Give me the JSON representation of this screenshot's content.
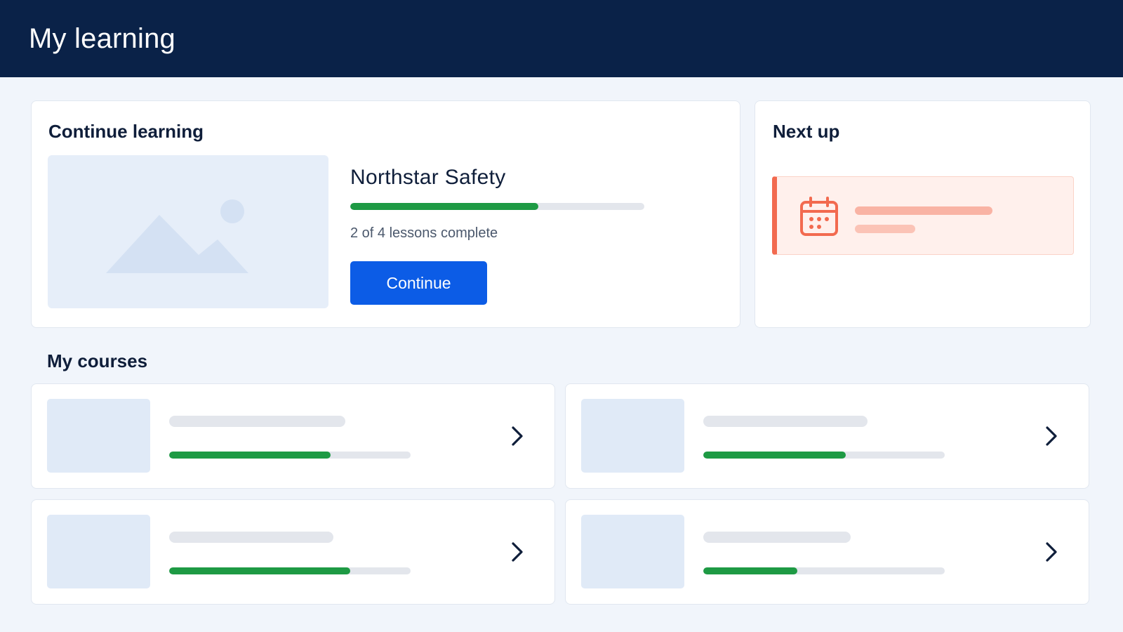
{
  "header": {
    "title": "My learning"
  },
  "continue_learning": {
    "title": "Continue learning",
    "course_name": "Northstar Safety",
    "progress": 0.64,
    "lessons_text": "2 of 4 lessons complete",
    "button_label": "Continue"
  },
  "next_up": {
    "title": "Next up",
    "accent_color": "#f26a4f",
    "icon": "calendar-icon"
  },
  "my_courses": {
    "title": "My courses",
    "courses": [
      {
        "progress": 0.67,
        "title_placeholder_fraction": 0.73
      },
      {
        "progress": 0.59,
        "title_placeholder_fraction": 0.68
      },
      {
        "progress": 0.75,
        "title_placeholder_fraction": 0.68
      },
      {
        "progress": 0.39,
        "title_placeholder_fraction": 0.61
      }
    ]
  },
  "colors": {
    "header_bg": "#0a2248",
    "primary_button": "#0c5ce6",
    "progress_fill": "#1e9a44",
    "progress_track": "#e3e6ec"
  }
}
